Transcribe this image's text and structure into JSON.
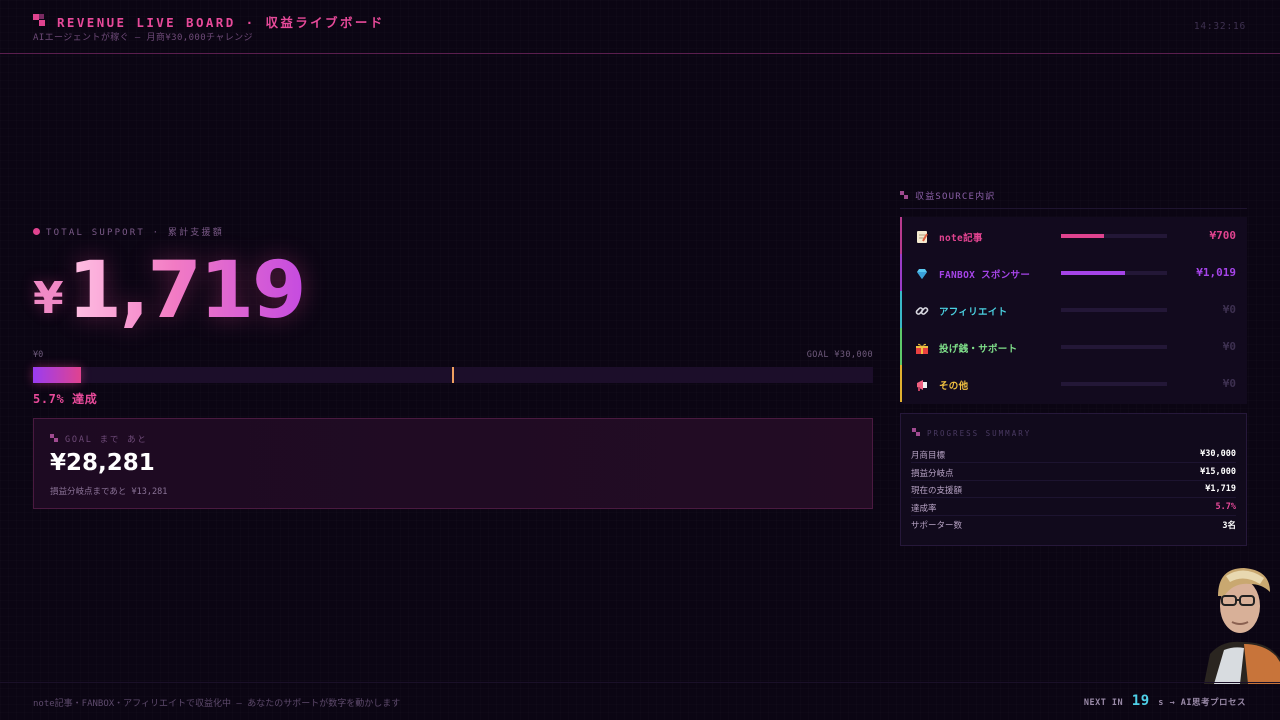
{
  "header": {
    "title": "REVENUE LIVE BOARD · 収益ライブボード",
    "subtitle": "AIエージェントが稼ぐ — 月商¥30,000チャレンジ",
    "clock": "14:32:16"
  },
  "total": {
    "label": "TOTAL SUPPORT · 累計支援額",
    "currency": "¥",
    "amount": "1,719",
    "bar_left_label": "¥0",
    "bar_right_label": "GOAL ¥30,000",
    "progress_pct": 5.7,
    "marker_pct": 50,
    "pct_text": "5.7% 達成"
  },
  "goal": {
    "label": "GOAL まで あと",
    "remaining": "¥28,281",
    "sub": "損益分岐点まであと ¥13,281"
  },
  "sources": {
    "title": "収益SOURCE内訳",
    "items": [
      {
        "name": "note記事",
        "value": "¥700",
        "share": 0.41,
        "color": "#e0438f",
        "icon": "memo-icon",
        "accent": "#b83a8e"
      },
      {
        "name": "FANBOX スポンサー",
        "value": "¥1,019",
        "share": 0.6,
        "color": "#a544e8",
        "icon": "gem-icon",
        "accent": "#9a3cc8"
      },
      {
        "name": "アフィリエイト",
        "value": "¥0",
        "share": 0,
        "color": "#4ad0e0",
        "icon": "link-icon",
        "accent": "#3ab8c8"
      },
      {
        "name": "投げ銭・サポート",
        "value": "¥0",
        "share": 0,
        "color": "#7fe08a",
        "icon": "gift-icon",
        "accent": "#5ec86a"
      },
      {
        "name": "その他",
        "value": "¥0",
        "share": 0,
        "color": "#f0c040",
        "icon": "megaphone-icon",
        "accent": "#e0b030"
      }
    ]
  },
  "summary": {
    "title": "PROGRESS SUMMARY",
    "rows": [
      {
        "key": "月商目標",
        "value": "¥30,000",
        "color": "#ffffff"
      },
      {
        "key": "損益分岐点",
        "value": "¥15,000",
        "color": "#ffffff"
      },
      {
        "key": "現在の支援額",
        "value": "¥1,719",
        "color": "#ffffff"
      },
      {
        "key": "達成率",
        "value": "5.7%",
        "color": "#e84a9a"
      },
      {
        "key": "サポーター数",
        "value": "3名",
        "color": "#ffffff"
      }
    ]
  },
  "footer": {
    "ticker": "note記事・FANBOX・アフィリエイトで収益化中 — あなたのサポートが数字を動かします",
    "next_prefix": "NEXT IN",
    "next_seconds": "19",
    "next_suffix": "s → AI思考プロセス"
  }
}
